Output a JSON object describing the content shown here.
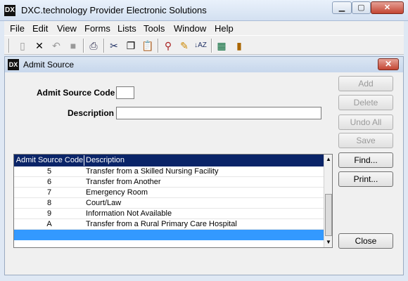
{
  "window": {
    "title": "DXC.technology Provider Electronic Solutions",
    "icon": "dxc-logo-icon"
  },
  "menu": [
    "File",
    "Edit",
    "View",
    "Forms",
    "Lists",
    "Tools",
    "Window",
    "Help"
  ],
  "child": {
    "title": "Admit Source"
  },
  "form": {
    "admit_source_code_label": "Admit Source Code",
    "admit_source_code_value": "",
    "description_label": "Description",
    "description_value": ""
  },
  "buttons": {
    "add": "Add",
    "delete": "Delete",
    "undo_all": "Undo All",
    "save": "Save",
    "find": "Find...",
    "print": "Print...",
    "close": "Close"
  },
  "grid": {
    "columns": [
      "Admit Source Code",
      "Description"
    ],
    "rows": [
      {
        "code": "5",
        "description": "Transfer from a Skilled Nursing Facility"
      },
      {
        "code": "6",
        "description": "Transfer from Another"
      },
      {
        "code": "7",
        "description": "Emergency Room"
      },
      {
        "code": "8",
        "description": "Court/Law"
      },
      {
        "code": "9",
        "description": "Information Not Available"
      },
      {
        "code": "A",
        "description": "Transfer from a Rural Primary Care Hospital"
      }
    ]
  },
  "colors": {
    "header_bg": "#0a2468",
    "selected_row": "#3399ff"
  }
}
